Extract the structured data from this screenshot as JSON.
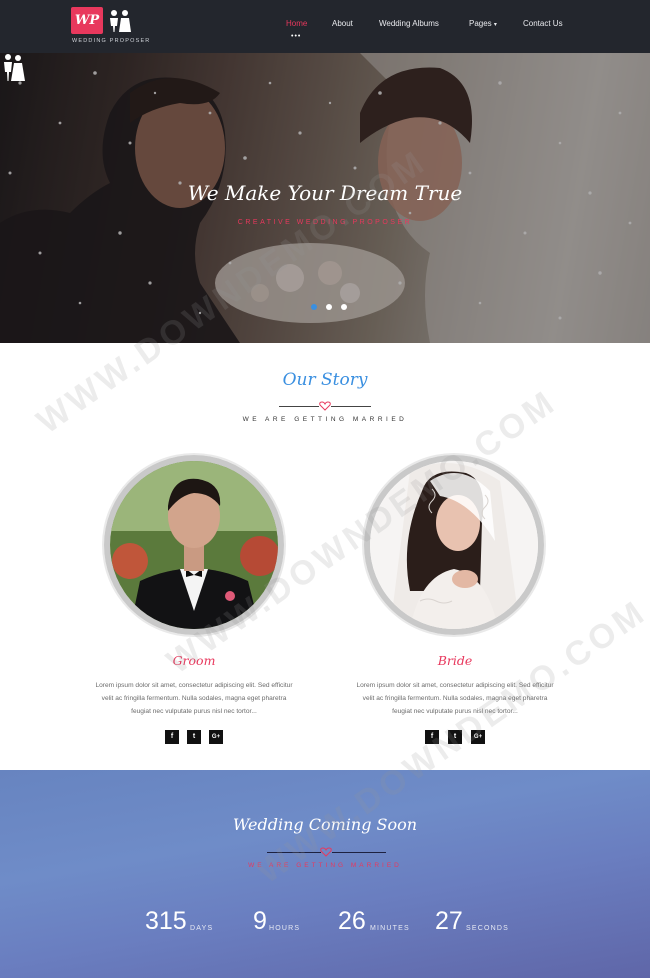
{
  "brand": {
    "logo_text": "WP",
    "tagline": "WEDDING PROPOSER"
  },
  "nav": {
    "items": [
      "Home",
      "About",
      "Wedding Albums",
      "Pages",
      "Contact Us"
    ],
    "active": "Home",
    "pages_caret": "▾"
  },
  "hero": {
    "title": "We Make Your Dream True",
    "subtitle": "CREATIVE WEDDING PROPOSER",
    "slides": 3,
    "active_slide": 1
  },
  "story": {
    "title": "Our Story",
    "subtitle": "WE ARE GETTING MARRIED",
    "groom": {
      "name": "Groom",
      "text1": "Lorem ipsum dolor sit amet, consectetur adipiscing elit. Sed efficitur",
      "text2": "velit ac fringilla fermentum. Nulla sodales, magna eget pharetra",
      "text3": "feugiat nec vulputate purus nisl nec tortor..."
    },
    "bride": {
      "name": "Bride",
      "text1": "Lorem ipsum dolor sit amet, consectetur adipiscing elit. Sed efficitur",
      "text2": "velit ac fringilla fermentum. Nulla sodales, magna eget pharetra",
      "text3": "feugiat nec vulputate purus nisl nec tortor..."
    },
    "social": [
      "f",
      "t",
      "G+"
    ]
  },
  "countdown": {
    "title": "Wedding Coming Soon",
    "subtitle": "WE ARE GETTING MARRIED",
    "days": "315",
    "days_label": "DAYS",
    "hours": "9",
    "hours_label": "HOURS",
    "minutes": "26",
    "minutes_label": "MINUTES",
    "seconds": "27",
    "seconds_label": "SECONDS"
  },
  "watermark": "WWW.DOWNDEMO.COM",
  "colors": {
    "accent": "#e8385d",
    "title_blue": "#3a8fe0",
    "navbar": "#23262d"
  }
}
